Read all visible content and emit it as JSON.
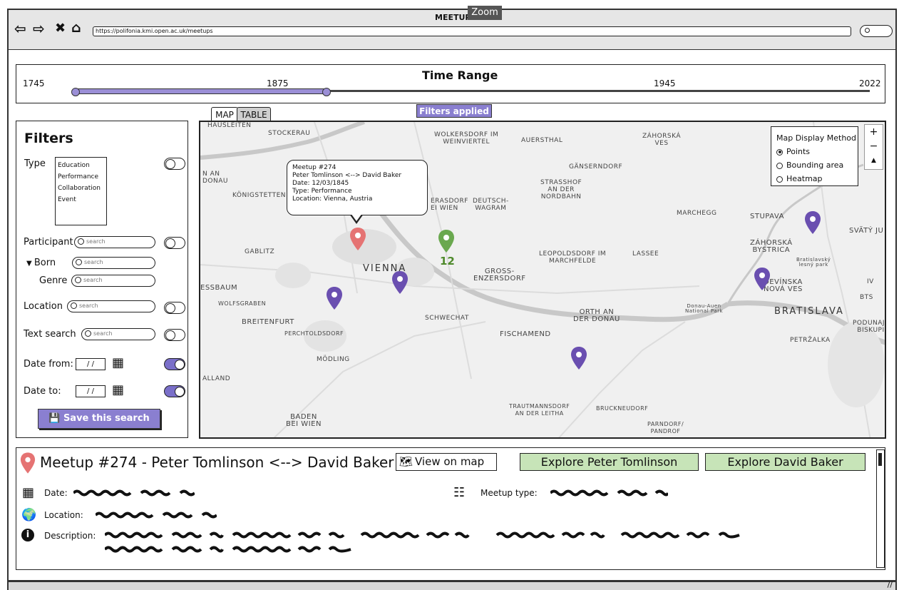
{
  "browser": {
    "title": "MEETUPS",
    "zoom_tooltip": "Zoom",
    "url": "https://polifonia.kmi.open.ac.uk/meetups",
    "nav_icons": [
      "back-arrow-icon",
      "forward-arrow-icon",
      "close-icon",
      "home-icon"
    ]
  },
  "time_range": {
    "title": "Time Range",
    "ticks": [
      "1745",
      "1875",
      "1945",
      "2022"
    ],
    "selected_start": "1745",
    "selected_end": "1875"
  },
  "tabs": {
    "map": "MAP",
    "table": "TABLE"
  },
  "filters_applied": "Filters applied",
  "filters": {
    "title": "Filters",
    "type_label": "Type",
    "type_options": [
      "Education",
      "Performance",
      "Collaboration",
      "Event"
    ],
    "participant_label": "Participant",
    "born_label": "Born",
    "genre_label": "Genre",
    "location_label": "Location",
    "text_search_label": "Text search",
    "date_from_label": "Date from:",
    "date_to_label": "Date to:",
    "search_placeholder": "search",
    "date_placeholder": "/ /",
    "save_label": "Save this search",
    "toggles": {
      "type": false,
      "participant": false,
      "location": false,
      "text_search": false,
      "date_from": true,
      "date_to": true
    }
  },
  "map": {
    "legend_title": "Map Display Method",
    "legend_options": [
      "Points",
      "Bounding area",
      "Heatmap"
    ],
    "selected_option": "Points",
    "zoom_in": "+",
    "zoom_out": "−",
    "compass": "▲",
    "places": {
      "hausleiten": "HAUSLEITEN",
      "stockerau": "STOCKERAU",
      "wolkersdorf": "WOLKERSDORF IM\nWEINVIERTEL",
      "auersthal": "AUERSTHAL",
      "zahorska_ves": "ZÁHORSKÁ\nVES",
      "gansern": "GÄNSERNDORF",
      "strasshof": "STRASSHOF\nAN DER\nNORDBAHN",
      "konig": "KÖNIGSTETTEN",
      "an_donau": "N AN\nDONAU",
      "gerasdorf": "ERASDORF\nEI WIEN",
      "deutsch_wagram": "DEUTSCH-\nWAGRAM",
      "marchegg": "MARCHEGG",
      "stupava": "STUPAVA",
      "svaty": "SVÄTÝ JU",
      "gablitz": "GABLITZ",
      "vienna": "VIENNA",
      "gross": "GROSS-\nENZERSDORF",
      "leopoldsdorf": "LEOPOLDSDORF IM\nMARCHFELDE",
      "lassee": "LASSEE",
      "zahorska_bystrica": "ZÁHORSKÁ\nBYSTRICA",
      "bratislavsky": "Bratislavský\nlesný park",
      "devinska": "DEVÍNSKA\nNOVÁ VES",
      "pressbaum": "ESSBAUM",
      "wolfsgraben": "WOLFSGRABEN",
      "breitenfurt": "BREITENFURT",
      "schwechat": "SCHWECHAT",
      "orth": "ORTH AN\nDER DONAU",
      "donau_auen": "Donau-Auen\nNational Park",
      "bratislava": "BRATISLAVA",
      "perchtoldsdorf": "PERCHTOLDSDORF",
      "fischamend": "FISCHAMEND",
      "petrzalka": "PETRŽALKA",
      "podunajske": "PODUNAJSK\nBISKUPIC",
      "iv": "IV",
      "bts": "BTS",
      "modling": "MÖDLING",
      "alland": "ALLAND",
      "trautmannsdorf": "TRAUTMANNSDORF\nAN DER LEITHA",
      "bruckneudorf": "BRUCKNEUDORF",
      "baden": "BADEN\nBEI WIEN",
      "parndorf": "PARNDORF/\nPANDROF"
    },
    "popup": {
      "line1": "Meetup #274",
      "line2": "Peter Tomlinson <--> David Baker",
      "line3": "Date: 12/03/1845",
      "line4": "Type: Performance",
      "line5": "Location: Vienna, Austria"
    },
    "cluster_count": "12",
    "colors": {
      "selected_pin": "#e57373",
      "cluster_pin": "#6aa84f",
      "pin": "#6a4fb0"
    }
  },
  "detail": {
    "title": "Meetup #274 - Peter Tomlinson <--> David Baker",
    "view_on_map": "View on map",
    "explore_1": "Explore Peter Tomlinson",
    "explore_2": "Explore David Baker",
    "date_label": "Date:",
    "meetup_type_label": "Meetup type:",
    "location_label": "Location:",
    "description_label": "Description:"
  }
}
